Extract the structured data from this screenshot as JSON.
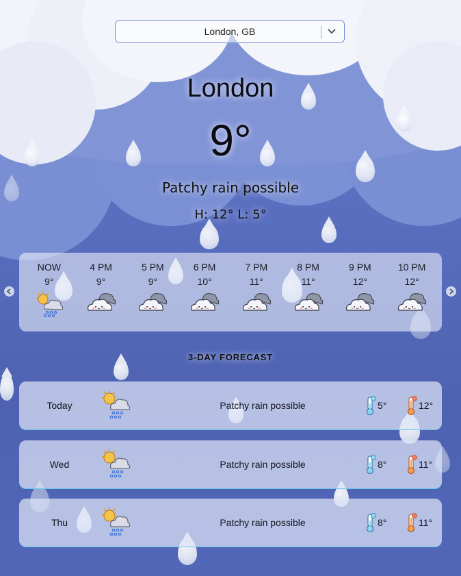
{
  "location_select": {
    "value": "London, GB"
  },
  "current": {
    "city": "London",
    "temperature": "9°",
    "condition": "Patchy rain possible",
    "hi_lo": "H: 12° L: 5°"
  },
  "hourly": [
    {
      "time": "NOW",
      "temp": "9°",
      "icon": "sun-cloud-rain-icon"
    },
    {
      "time": "4 PM",
      "temp": "9°",
      "icon": "night-cloud-icon"
    },
    {
      "time": "5 PM",
      "temp": "9°",
      "icon": "night-cloud-icon"
    },
    {
      "time": "6 PM",
      "temp": "10°",
      "icon": "night-cloud-icon"
    },
    {
      "time": "7 PM",
      "temp": "11°",
      "icon": "night-cloud-icon"
    },
    {
      "time": "8 PM",
      "temp": "11°",
      "icon": "night-cloud-icon"
    },
    {
      "time": "9 PM",
      "temp": "12°",
      "icon": "night-cloud-icon"
    },
    {
      "time": "10 PM",
      "temp": "12°",
      "icon": "night-cloud-icon"
    }
  ],
  "forecast_title": "3-DAY FORECAST",
  "forecast": [
    {
      "day": "Today",
      "condition": "Patchy rain possible",
      "low": "5°",
      "high": "12°",
      "icon": "sun-cloud-rain-icon"
    },
    {
      "day": "Wed",
      "condition": "Patchy rain possible",
      "low": "8°",
      "high": "11°",
      "icon": "sun-cloud-rain-icon"
    },
    {
      "day": "Thu",
      "condition": "Patchy rain possible",
      "low": "8°",
      "high": "11°",
      "icon": "sun-cloud-rain-icon"
    }
  ],
  "colors": {
    "sky_top": "#6e84cf",
    "sky_bottom": "#4e62b1",
    "card_accent": "#66c8e8",
    "select_border": "#6f8ad6"
  }
}
